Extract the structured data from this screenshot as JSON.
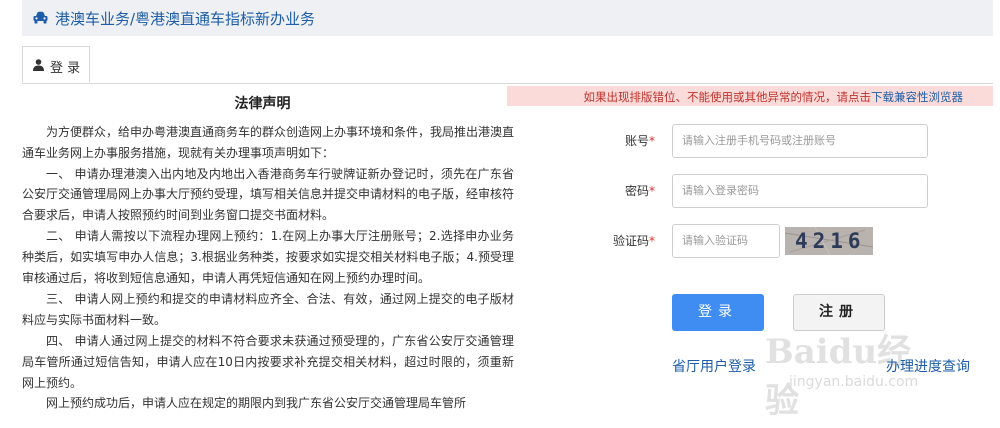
{
  "header": {
    "title": "港澳车业务/粤港澳直通车指标新办业务",
    "icon": "car-icon"
  },
  "tab": {
    "label": "登 录",
    "icon": "user-icon"
  },
  "legal": {
    "title": "法律声明",
    "paragraphs": [
      "为方便群众，给申办粤港澳直通商务车的群众创造网上办事环境和条件，我局推出港澳直通车业务网上办事服务措施，现就有关办理事项声明如下：",
      "一、  申请办理港澳入出内地及内地出入香港商务车行驶牌证新办登记时，须先在广东省公安厅交通管理局网上办事大厅预约受理，填写相关信息并提交申请材料的电子版，经审核符合要求后，申请人按照预约时间到业务窗口提交书面材料。",
      "二、  申请人需按以下流程办理网上预约：1.在网上办事大厅注册账号；2.选择申办业务种类后，如实填写申办人信息；3.根据业务种类，按要求如实提交相关材料电子版；4.预受理审核通过后，将收到短信息通知，申请人再凭短信通知在网上预约办理时间。",
      "三、  申请人网上预约和提交的申请材料应齐全、合法、有效，通过网上提交的电子版材料应与实际书面材料一致。",
      "四、  申请人通过网上提交的材料不符合要求未获通过预受理的，广东省公安厅交通管理局车管所通过短信告知，申请人应在10日内按要求补充提交相关材料，超过时限的，须重新网上预约。",
      "网上预约成功后，申请人应在规定的期限内到我广东省公安厅交通管理局车管所"
    ]
  },
  "compat": {
    "text": "如果出现排版错位、不能使用或其他异常的情况，请点击",
    "link": "下载兼容性浏览器"
  },
  "form": {
    "account_label": "账号",
    "account_placeholder": "请输入注册手机号码或注册账号",
    "password_label": "密码",
    "password_placeholder": "请输入登录密码",
    "captcha_label": "验证码",
    "captcha_placeholder": "请输入验证码",
    "captcha_value": "4216",
    "required_mark": "*",
    "login_button": "登录",
    "register_button": "注册"
  },
  "links": {
    "province_login": "省厅用户登录",
    "progress_query": "办理进度查询"
  },
  "watermark": {
    "logo": "Baidu经验",
    "site": "jingyan.baidu.com"
  },
  "colors": {
    "accent": "#3f8cf2",
    "link": "#1e5ea8",
    "warning_bg": "#fadbd9",
    "warning_text": "#c0312b"
  }
}
